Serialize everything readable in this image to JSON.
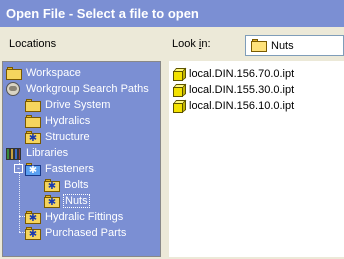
{
  "window": {
    "title": "Open File - Select a file to open"
  },
  "locations": {
    "label": "Locations",
    "tree": [
      {
        "label": "Workspace",
        "icon": "folder-icon"
      },
      {
        "label": "Workgroup Search Paths",
        "icon": "globe-icon"
      },
      {
        "label": "Drive System",
        "icon": "folder-icon"
      },
      {
        "label": "Hydralics",
        "icon": "folder-icon"
      },
      {
        "label": "Structure",
        "icon": "star-folder-icon"
      },
      {
        "label": "Libraries",
        "icon": "books-icon"
      },
      {
        "label": "Fasteners",
        "icon": "blue-star-folder-icon",
        "expander": "-"
      },
      {
        "label": "Bolts",
        "icon": "star-folder-icon"
      },
      {
        "label": "Nuts",
        "icon": "star-folder-icon",
        "selected": true
      },
      {
        "label": "Hydralic Fittings",
        "icon": "star-folder-icon"
      },
      {
        "label": "Purchased Parts",
        "icon": "star-folder-icon"
      }
    ]
  },
  "lookin": {
    "label_prefix": "Look ",
    "label_accel": "i",
    "label_suffix": "n:",
    "value": "Nuts"
  },
  "files": [
    {
      "name": "local.DIN.156.70.0.ipt"
    },
    {
      "name": "local.DIN.155.30.0.ipt"
    },
    {
      "name": "local.DIN.156.10.0.ipt"
    }
  ],
  "colors": {
    "title_bar": "#7b8fd3",
    "tree_background": "#7b8fd3",
    "dialog_background": "#ece9d8"
  }
}
